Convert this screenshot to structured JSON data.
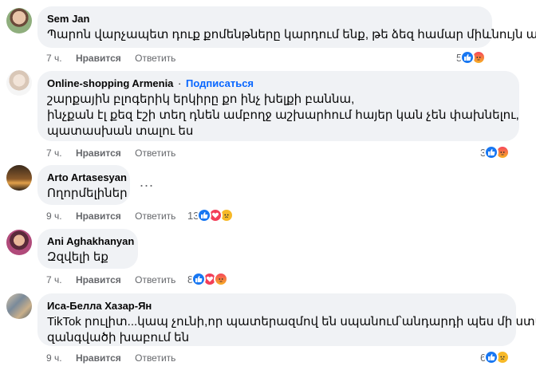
{
  "comments": [
    {
      "author": "Sem Jan",
      "text": [
        "Պարոն վարչապետ դուք քոմենթները կարդում ենք, թե ձեզ համար միևնույն ա ?"
      ],
      "time": "7 ч.",
      "like_label": "Нравится",
      "reply_label": "Ответить",
      "reaction_count": "5",
      "reactions": [
        "like-icon",
        "angry-icon"
      ]
    },
    {
      "author": "Online-shopping Armenia",
      "follow_label": "Подписаться",
      "text": [
        "շարքային բլոգերիկ երկիրը քո ինչ խելքի բաննա,",
        "ինչքան էլ քեզ էշի տեղ դնեն ամբողջ աշխարհում հայեր կան չեն փախնելու,",
        "պատասխան տալու ես"
      ],
      "time": "7 ч.",
      "like_label": "Нравится",
      "reply_label": "Ответить",
      "reaction_count": "3",
      "reactions": [
        "like-icon",
        "angry-icon"
      ]
    },
    {
      "author": "Arto Artasesyan",
      "text": [
        "Ողորմելիներ"
      ],
      "time": "9 ч.",
      "like_label": "Нравится",
      "reply_label": "Ответить",
      "reaction_count": "13",
      "reactions": [
        "like-icon",
        "love-icon",
        "sad-icon"
      ],
      "more_label": "..."
    },
    {
      "author": "Ani Aghakhanyan",
      "text": [
        "Զզվելի եք"
      ],
      "time": "7 ч.",
      "like_label": "Нравится",
      "reply_label": "Ответить",
      "reaction_count": "8",
      "reactions": [
        "like-icon",
        "love-icon",
        "angry-icon"
      ]
    },
    {
      "author": "Иса-Белла Хазар-Ян",
      "text": [
        "TikTok րուլիտ...կապ չունի,որ պատերազմով են սպանում՝անդարդի պես մի ստվար",
        "զանգվածի խաբում են"
      ],
      "time": "9 ч.",
      "like_label": "Нравится",
      "reply_label": "Ответить",
      "reaction_count": "6",
      "reactions": [
        "like-icon",
        "sad-icon"
      ]
    }
  ],
  "colors": {
    "bubble": "#f0f2f5",
    "link": "#0866ff",
    "meta": "#65676b"
  }
}
